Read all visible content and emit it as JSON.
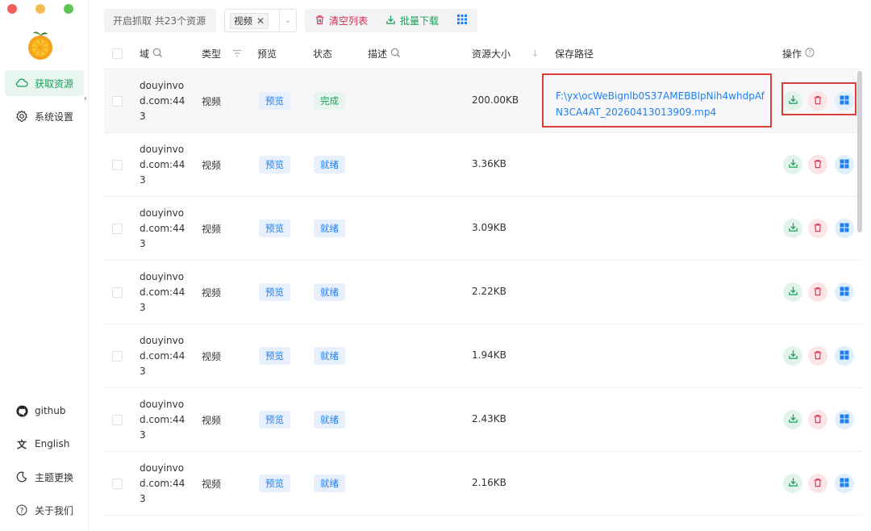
{
  "sidebar": {
    "nav": [
      {
        "label": "获取资源",
        "icon": "cloud-icon",
        "active": true
      },
      {
        "label": "系统设置",
        "icon": "gear-icon",
        "active": false
      }
    ],
    "bottom": [
      {
        "label": "github",
        "icon": "github-icon"
      },
      {
        "label": "English",
        "icon": "translate-icon"
      },
      {
        "label": "主题更换",
        "icon": "moon-icon"
      },
      {
        "label": "关于我们",
        "icon": "help-icon"
      }
    ]
  },
  "toolbar": {
    "capture_label": "开启抓取 共23个资源",
    "filter_tag": "视频",
    "clear_label": "清空列表",
    "batch_download_label": "批量下载",
    "grid_icon": "grid-icon"
  },
  "table": {
    "headers": {
      "domain": "域",
      "type": "类型",
      "preview": "预览",
      "status": "状态",
      "desc": "描述",
      "size": "资源大小",
      "path": "保存路径",
      "ops": "操作"
    },
    "rows": [
      {
        "domain_l1": "douyinvo",
        "domain_l2": "d.com:44",
        "domain_l3": "3",
        "type": "视频",
        "preview": "预览",
        "status": "完成",
        "size": "200.00KB",
        "path_l1": "F:\\yx\\ocWeBignlb0S37AMEBBlpNih4whdpAf",
        "path_l2": "N3CA4AT_20260413013909.mp4"
      },
      {
        "domain_l1": "douyinvo",
        "domain_l2": "d.com:44",
        "domain_l3": "3",
        "type": "视频",
        "preview": "预览",
        "status": "就绪",
        "size": "3.36KB"
      },
      {
        "domain_l1": "douyinvo",
        "domain_l2": "d.com:44",
        "domain_l3": "3",
        "type": "视频",
        "preview": "预览",
        "status": "就绪",
        "size": "3.09KB"
      },
      {
        "domain_l1": "douyinvo",
        "domain_l2": "d.com:44",
        "domain_l3": "3",
        "type": "视频",
        "preview": "预览",
        "status": "就绪",
        "size": "2.22KB"
      },
      {
        "domain_l1": "douyinvo",
        "domain_l2": "d.com:44",
        "domain_l3": "3",
        "type": "视频",
        "preview": "预览",
        "status": "就绪",
        "size": "1.94KB"
      },
      {
        "domain_l1": "douyinvo",
        "domain_l2": "d.com:44",
        "domain_l3": "3",
        "type": "视频",
        "preview": "预览",
        "status": "就绪",
        "size": "2.43KB"
      },
      {
        "domain_l1": "douyinvo",
        "domain_l2": "d.com:44",
        "domain_l3": "3",
        "type": "视频",
        "preview": "预览",
        "status": "就绪",
        "size": "2.16KB"
      }
    ]
  },
  "colors": {
    "accent": "#18a058",
    "danger": "#d03050",
    "info": "#2080f0",
    "highlight_border": "#d9403a"
  }
}
